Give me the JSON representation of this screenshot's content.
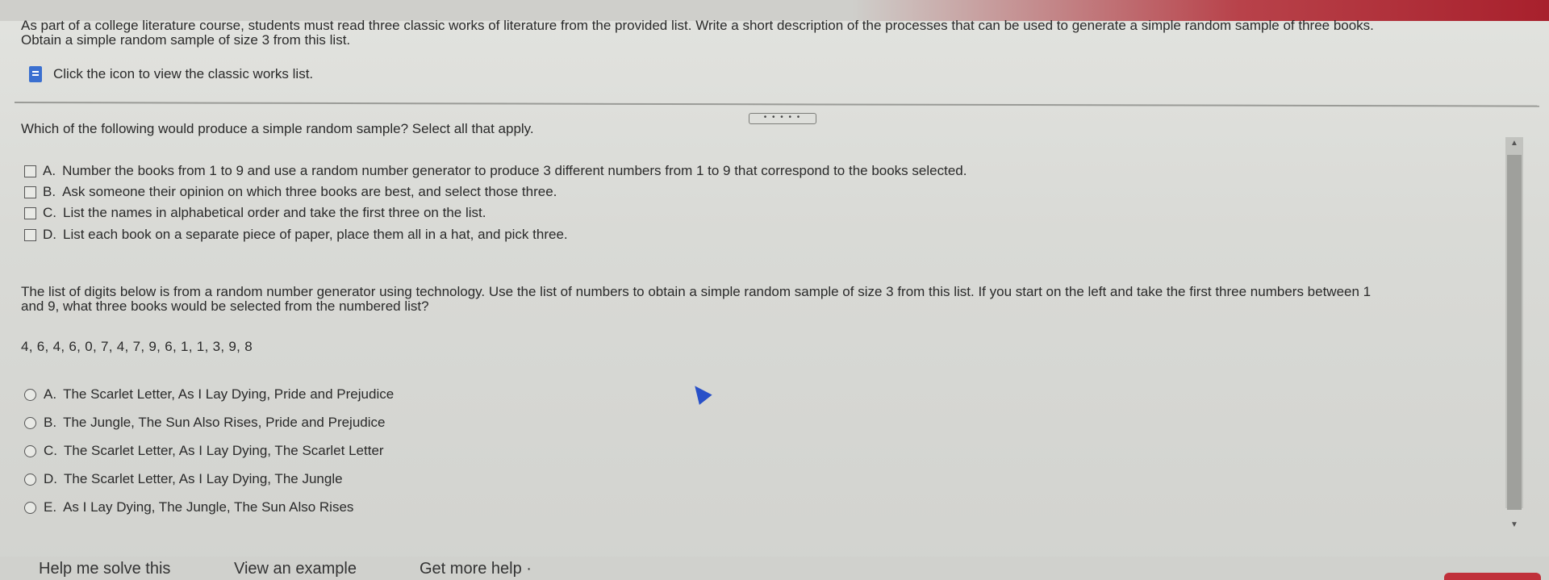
{
  "intro": {
    "line1": "As part of a college literature course, students must read three classic works of literature from the provided list. Write a short description of the processes that can be used to generate a simple random sample of three books.",
    "line2": "Obtain a simple random sample of size 3 from this list."
  },
  "icon_row": {
    "label": "Click the icon to view the classic works list.",
    "icon": "book-list-icon"
  },
  "expand_label": "• • • • •",
  "question1": {
    "prompt": "Which of the following would produce a simple random sample? Select all that apply.",
    "options": [
      {
        "letter": "A.",
        "text": "Number the books from 1 to 9 and use a random number generator to produce 3 different numbers from 1 to 9 that correspond to the books selected."
      },
      {
        "letter": "B.",
        "text": "Ask someone their opinion on which three books are best, and select those three."
      },
      {
        "letter": "C.",
        "text": "List the names in alphabetical order and take the first three on the list."
      },
      {
        "letter": "D.",
        "text": "List each book on a separate piece of paper, place them all in a hat, and pick three."
      }
    ]
  },
  "question2": {
    "prompt_line1": "The list of digits below is from a random number generator using technology. Use the list of numbers to obtain a simple random sample of size 3 from this list. If you start on the left and take the first three numbers between 1",
    "prompt_line2": "and 9, what three books would be selected from the numbered list?",
    "digits": "4, 6, 4, 6, 0, 7, 4, 7, 9, 6, 1, 1, 3, 9, 8",
    "options": [
      {
        "letter": "A.",
        "text": "The Scarlet Letter, As I Lay Dying, Pride and Prejudice"
      },
      {
        "letter": "B.",
        "text": "The Jungle, The Sun Also Rises, Pride and Prejudice"
      },
      {
        "letter": "C.",
        "text": "The Scarlet Letter, As I Lay Dying, The Scarlet Letter"
      },
      {
        "letter": "D.",
        "text": "The Scarlet Letter, As I Lay Dying, The Jungle"
      },
      {
        "letter": "E.",
        "text": "As I Lay Dying, The Jungle, The Sun Also Rises"
      }
    ]
  },
  "bottom": {
    "help": "Help me solve this",
    "example": "View an example",
    "more": "Get more help ·"
  },
  "colors": {
    "accent_red": "#a8202c",
    "icon_blue": "#3a6fd0"
  }
}
